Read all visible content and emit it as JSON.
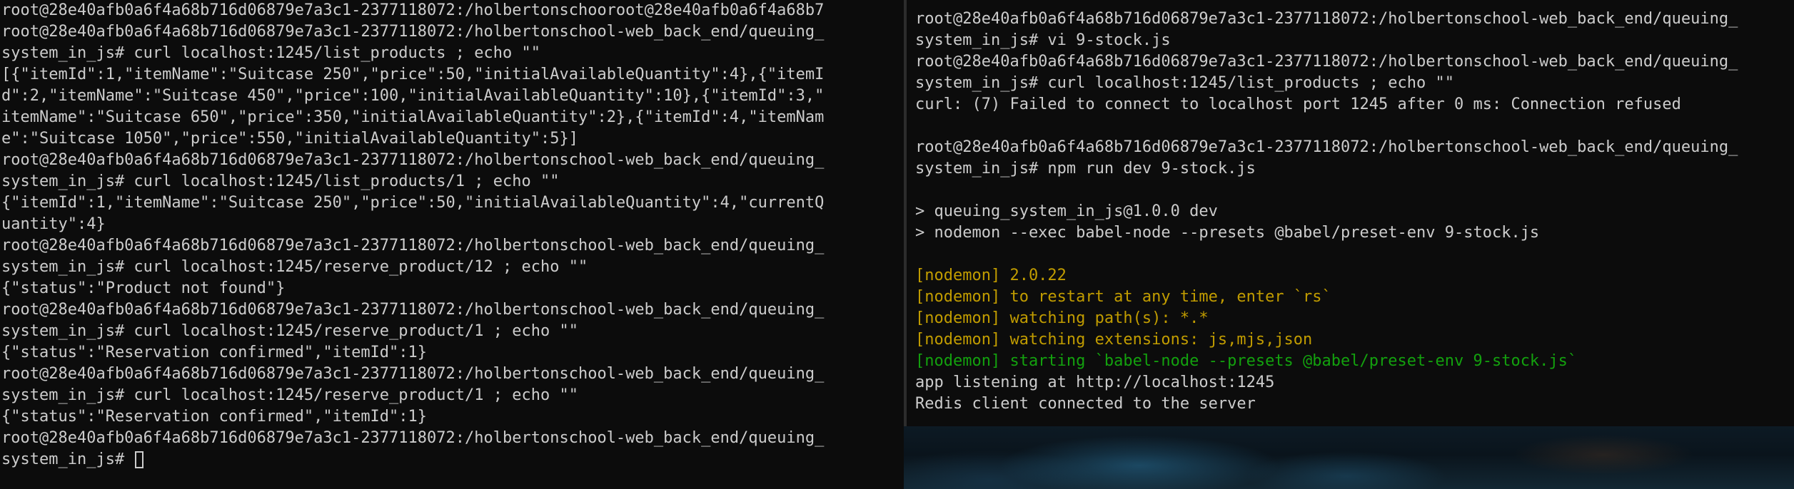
{
  "colors": {
    "terminal_bg": "#0c0c0c",
    "text": "#cccccc",
    "nodemon_yellow": "#c19c00",
    "nodemon_green": "#13a10e",
    "divider": "#2d2d2d"
  },
  "left_terminal": {
    "lines": [
      "root@28e40afb0a6f4a68b716d06879e7a3c1-2377118072:/holbertonschooroot@28e40afb0a6f4a68b7",
      "root@28e40afb0a6f4a68b716d06879e7a3c1-2377118072:/holbertonschool-web_back_end/queuing_",
      "system_in_js# curl localhost:1245/list_products ; echo \"\"",
      "[{\"itemId\":1,\"itemName\":\"Suitcase 250\",\"price\":50,\"initialAvailableQuantity\":4},{\"itemI",
      "d\":2,\"itemName\":\"Suitcase 450\",\"price\":100,\"initialAvailableQuantity\":10},{\"itemId\":3,\"",
      "itemName\":\"Suitcase 650\",\"price\":350,\"initialAvailableQuantity\":2},{\"itemId\":4,\"itemNam",
      "e\":\"Suitcase 1050\",\"price\":550,\"initialAvailableQuantity\":5}]",
      "root@28e40afb0a6f4a68b716d06879e7a3c1-2377118072:/holbertonschool-web_back_end/queuing_",
      "system_in_js# curl localhost:1245/list_products/1 ; echo \"\"",
      "{\"itemId\":1,\"itemName\":\"Suitcase 250\",\"price\":50,\"initialAvailableQuantity\":4,\"currentQ",
      "uantity\":4}",
      "root@28e40afb0a6f4a68b716d06879e7a3c1-2377118072:/holbertonschool-web_back_end/queuing_",
      "system_in_js# curl localhost:1245/reserve_product/12 ; echo \"\"",
      "{\"status\":\"Product not found\"}",
      "root@28e40afb0a6f4a68b716d06879e7a3c1-2377118072:/holbertonschool-web_back_end/queuing_",
      "system_in_js# curl localhost:1245/reserve_product/1 ; echo \"\"",
      "{\"status\":\"Reservation confirmed\",\"itemId\":1}",
      "root@28e40afb0a6f4a68b716d06879e7a3c1-2377118072:/holbertonschool-web_back_end/queuing_",
      "system_in_js# curl localhost:1245/reserve_product/1 ; echo \"\"",
      "{\"status\":\"Reservation confirmed\",\"itemId\":1}",
      "root@28e40afb0a6f4a68b716d06879e7a3c1-2377118072:/holbertonschool-web_back_end/queuing_"
    ],
    "prompt_line": "system_in_js# "
  },
  "right_terminal": {
    "lines": [
      {
        "text": "root@28e40afb0a6f4a68b716d06879e7a3c1-2377118072:/holbertonschool-web_back_end/queuing_",
        "color": "default"
      },
      {
        "text": "system_in_js# vi 9-stock.js",
        "color": "default"
      },
      {
        "text": "root@28e40afb0a6f4a68b716d06879e7a3c1-2377118072:/holbertonschool-web_back_end/queuing_",
        "color": "default"
      },
      {
        "text": "system_in_js# curl localhost:1245/list_products ; echo \"\"",
        "color": "default"
      },
      {
        "text": "curl: (7) Failed to connect to localhost port 1245 after 0 ms: Connection refused",
        "color": "default"
      },
      {
        "text": "",
        "color": "default"
      },
      {
        "text": "root@28e40afb0a6f4a68b716d06879e7a3c1-2377118072:/holbertonschool-web_back_end/queuing_",
        "color": "default"
      },
      {
        "text": "system_in_js# npm run dev 9-stock.js",
        "color": "default"
      },
      {
        "text": "",
        "color": "default"
      },
      {
        "text": "> queuing_system_in_js@1.0.0 dev",
        "color": "default"
      },
      {
        "text": "> nodemon --exec babel-node --presets @babel/preset-env 9-stock.js",
        "color": "default"
      },
      {
        "text": "",
        "color": "default"
      },
      {
        "text": "[nodemon] 2.0.22",
        "color": "yellow"
      },
      {
        "text": "[nodemon] to restart at any time, enter `rs`",
        "color": "yellow"
      },
      {
        "text": "[nodemon] watching path(s): *.*",
        "color": "yellow"
      },
      {
        "text": "[nodemon] watching extensions: js,mjs,json",
        "color": "yellow"
      },
      {
        "text": "[nodemon] starting `babel-node --presets @babel/preset-env 9-stock.js`",
        "color": "green"
      },
      {
        "text": "app listening at http://localhost:1245",
        "color": "default"
      },
      {
        "text": "Redis client connected to the server",
        "color": "default"
      }
    ]
  }
}
